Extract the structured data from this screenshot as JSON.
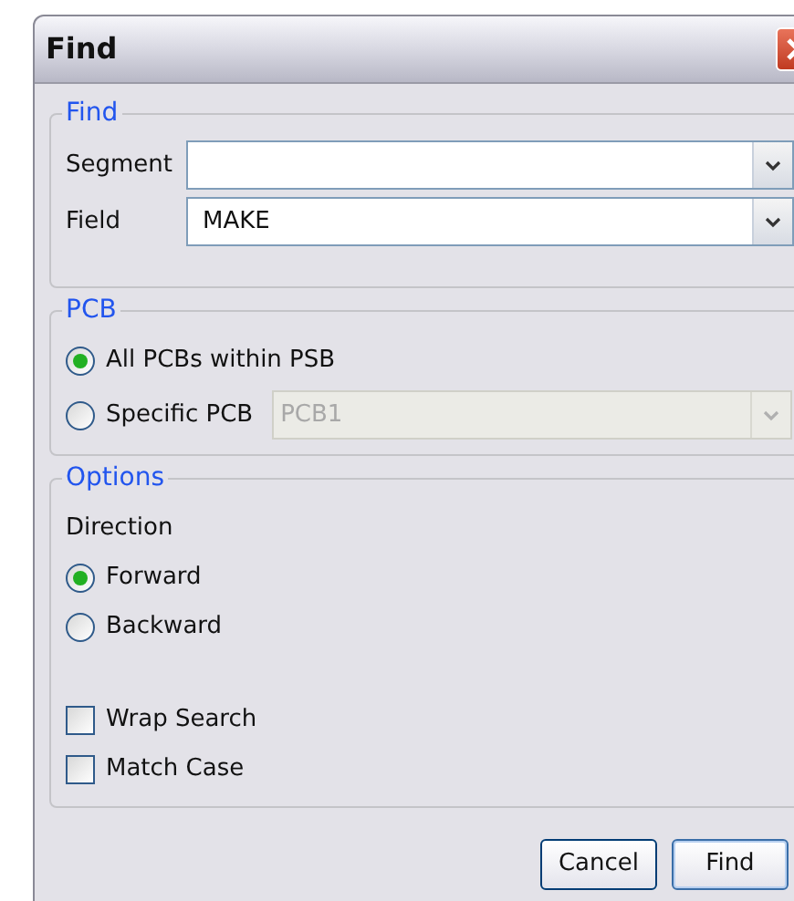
{
  "window": {
    "title": "Find"
  },
  "find_group": {
    "title": "Find",
    "fields": [
      {
        "label": "Segment"
      },
      {
        "label": "Field",
        "value": "MAKE"
      }
    ]
  },
  "pcb_group": {
    "title": "PCB",
    "options": [
      {
        "label": "All PCBs within PSB",
        "selected": true
      },
      {
        "label": "Specific PCB",
        "selected": false
      }
    ],
    "pcb_select": {
      "value": "PCB1",
      "disabled": true
    }
  },
  "options_group": {
    "title": "Options",
    "direction_label": "Direction",
    "directions": [
      {
        "label": "Forward",
        "selected": true
      },
      {
        "label": "Backward",
        "selected": false
      }
    ],
    "checks": [
      {
        "label": "Wrap Search",
        "checked": false
      },
      {
        "label": "Match Case",
        "checked": false
      }
    ]
  },
  "buttons": [
    {
      "label": "Cancel",
      "default": false
    },
    {
      "label": "Find",
      "default": true
    }
  ]
}
